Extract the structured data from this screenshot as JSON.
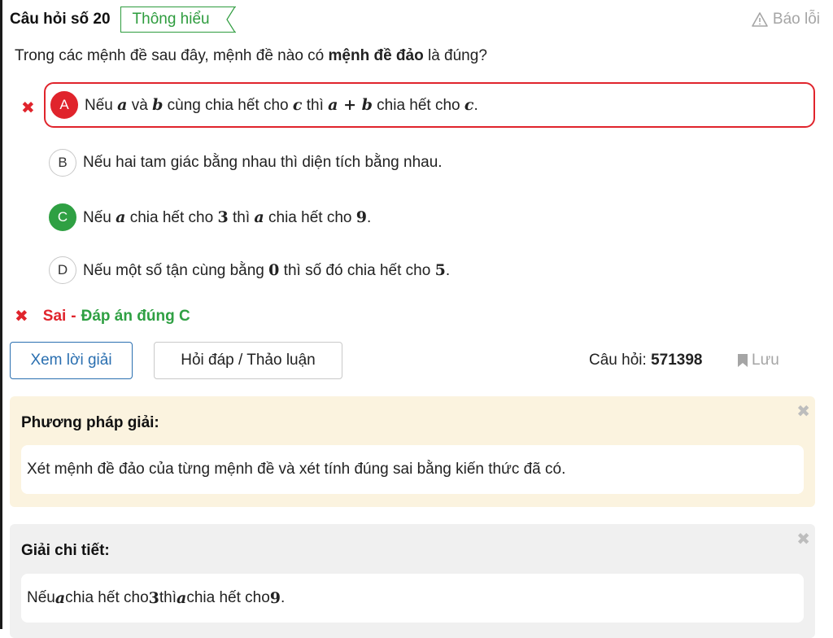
{
  "question": {
    "number_label": "Câu hỏi số 20",
    "level": "Thông hiểu",
    "report_label": "Báo lỗi",
    "text_before": "Trong các mệnh đề sau đây, mệnh đề nào có ",
    "text_bold": "mệnh đề đảo",
    "text_after": " là đúng?"
  },
  "options": [
    {
      "letter": "A",
      "state": "selected-wrong",
      "parts": [
        "Nếu ",
        "a",
        " và ",
        "b",
        " cùng chia hết cho ",
        "c",
        " thì ",
        "a + b",
        " chia hết cho ",
        "c",
        "."
      ]
    },
    {
      "letter": "B",
      "state": "neutral",
      "text": "Nếu hai tam giác bằng nhau thì diện tích bằng nhau."
    },
    {
      "letter": "C",
      "state": "correct",
      "parts": [
        "Nếu ",
        "a",
        " chia hết cho ",
        "3",
        " thì ",
        "a",
        " chia hết cho ",
        "9",
        "."
      ]
    },
    {
      "letter": "D",
      "state": "neutral",
      "parts": [
        "Nếu một số tận cùng bằng ",
        "0",
        " thì số đó chia hết cho ",
        "5",
        "."
      ]
    }
  ],
  "result": {
    "wrong_label": "Sai",
    "separator": "-",
    "answer_label": "Đáp án đúng C"
  },
  "buttons": {
    "solution": "Xem lời giải",
    "discussion": "Hỏi đáp / Thảo luận"
  },
  "meta": {
    "qid_label": "Câu hỏi:",
    "qid_value": "571398",
    "save_label": "Lưu"
  },
  "method_panel": {
    "title": "Phương pháp giải:",
    "body": "Xét mệnh đề đảo của từng mệnh đề và xét tính đúng sai bằng kiến thức đã có."
  },
  "detail_panel": {
    "title": "Giải chi tiết:",
    "parts": [
      "Nếu ",
      "a",
      " chia hết cho ",
      "3",
      " thì ",
      "a",
      " chia hết cho ",
      "9",
      "."
    ]
  },
  "colors": {
    "wrong": "#e0242c",
    "correct": "#2fa043",
    "link": "#2a6fb0",
    "method_bg": "#fbf3df",
    "detail_bg": "#f0f0f0"
  },
  "icons": {
    "report": "warning-triangle-icon",
    "save": "bookmark-icon",
    "wrong_mark": "cross-icon",
    "close": "close-icon"
  }
}
